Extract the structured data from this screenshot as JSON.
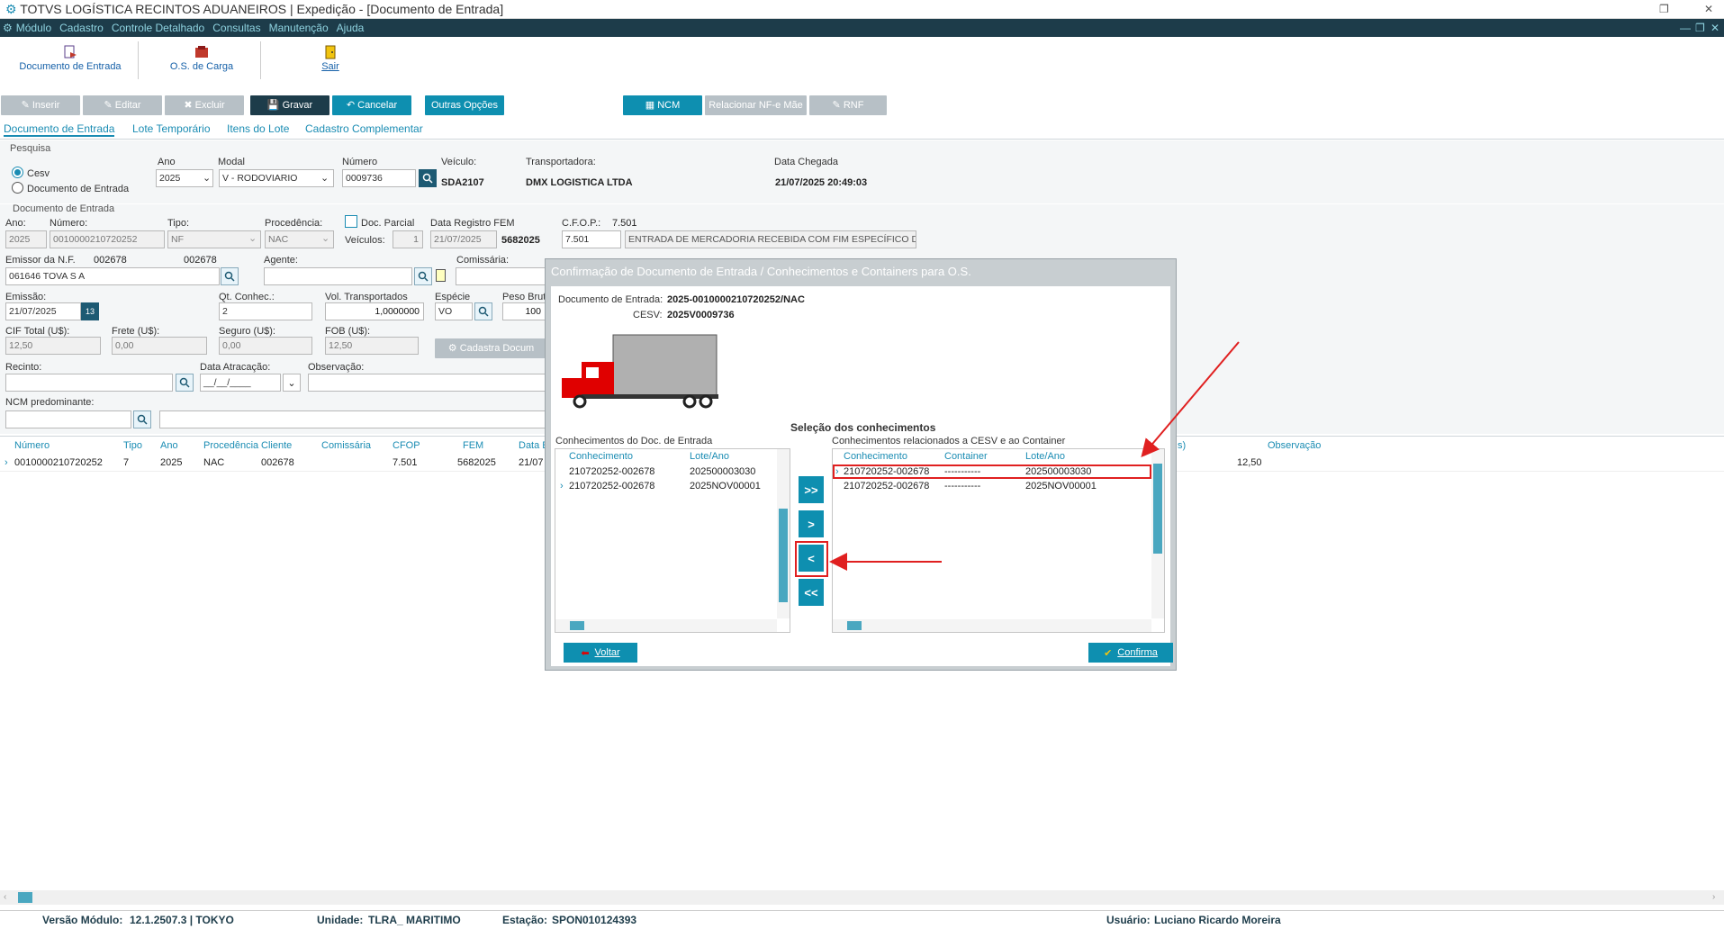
{
  "window": {
    "title": "TOTVS LOGÍSTICA RECINTOS ADUANEIROS | Expedição - [Documento de Entrada]"
  },
  "menu": [
    "Módulo",
    "Cadastro",
    "Controle Detalhado",
    "Consultas",
    "Manutenção",
    "Ajuda"
  ],
  "shortcuts": [
    {
      "label": "Documento de Entrada",
      "icon": "document-entry-icon"
    },
    {
      "label": "O.S. de Carga",
      "icon": "cargo-order-icon"
    },
    {
      "label": "Sair",
      "icon": "exit-door-icon"
    }
  ],
  "toolbar": {
    "inserir": "Inserir",
    "editar": "Editar",
    "excluir": "Excluir",
    "gravar": "Gravar",
    "cancelar": "Cancelar",
    "outras": "Outras Opções",
    "ncm": "NCM",
    "relacionar": "Relacionar NF-e Mãe",
    "rnf": "RNF"
  },
  "tabs": [
    "Documento de Entrada",
    "Lote Temporário",
    "Itens do Lote",
    "Cadastro Complementar"
  ],
  "pesquisa": {
    "title": "Pesquisa",
    "radio_cesv": "Cesv",
    "radio_doc": "Documento de Entrada",
    "ano_label": "Ano",
    "ano": "2025",
    "modal_label": "Modal",
    "modal": "V - RODOVIARIO",
    "numero_label": "Número",
    "numero": "0009736",
    "veiculo_label": "Veículo:",
    "veiculo": "SDA2107",
    "transportadora_label": "Transportadora:",
    "transportadora": "DMX LOGISTICA LTDA",
    "chegada_label": "Data Chegada",
    "chegada": "21/07/2025 20:49:03"
  },
  "doc": {
    "title": "Documento de Entrada",
    "ano_label": "Ano:",
    "ano": "2025",
    "numero_label": "Número:",
    "numero": "0010000210720252",
    "tipo_label": "Tipo:",
    "tipo": "NF",
    "procedencia_label": "Procedência:",
    "procedencia": "NAC",
    "docparcial_label": "Doc. Parcial",
    "veiculos_label": "Veículos:",
    "veiculos": "1",
    "registro_label": "Data Registro FEM",
    "registro": "21/07/2025",
    "fem": "5682025",
    "cfop_label": "C.F.O.P.:",
    "cfop_top": "7.501",
    "cfop": "7.501",
    "cfop_desc": "ENTRADA DE MERCADORIA RECEBIDA COM FIM ESPECÍFICO DE",
    "emissor_label": "Emissor da N.F.",
    "emissor_code1": "002678",
    "emissor_code2": "002678",
    "emissor": "061646  TOVA S A",
    "agente_label": "Agente:",
    "comissaria_label": "Comissária:",
    "emissao_label": "Emissão:",
    "emissao": "21/07/2025",
    "qtconhec_label": "Qt. Conhec.:",
    "qtconhec": "2",
    "vol_label": "Vol. Transportados",
    "vol": "1,0000000",
    "especie_label": "Espécie",
    "especie": "VO",
    "peso_label": "Peso Brut",
    "peso": "100",
    "cif_label": "CIF Total (U$):",
    "cif": "12,50",
    "frete_label": "Frete (U$):",
    "frete": "0,00",
    "seguro_label": "Seguro (U$):",
    "seguro": "0,00",
    "fob_label": "FOB (U$):",
    "fob": "12,50",
    "cadastra": "Cadastra Docum",
    "recinto_label": "Recinto:",
    "atracacao_label": "Data Atracação:",
    "atracacao": "__/__/____",
    "observacao_label": "Observação:",
    "ncm_label": "NCM predominante:"
  },
  "grid": {
    "headers": [
      "Número",
      "Tipo",
      "Ano",
      "Procedência",
      "Cliente",
      "Comissária",
      "CFOP",
      "FEM",
      "Data E",
      "s)",
      "Observação"
    ],
    "row": {
      "numero": "0010000210720252",
      "tipo": "7",
      "ano": "2025",
      "procedencia": "NAC",
      "cliente": "002678",
      "cfop": "7.501",
      "fem": "5682025",
      "data": "21/07",
      "valor": "12,50"
    }
  },
  "dialog": {
    "title": "Confirmação de Documento de Entrada / Conhecimentos  e Containers para O.S.",
    "doc_label": "Documento de Entrada:",
    "doc_value": "2025-0010000210720252/NAC",
    "cesv_label": "CESV:",
    "cesv_value": "2025V0009736",
    "section_title": "Seleção dos conhecimentos",
    "left_title": "Conhecimentos do Doc. de Entrada",
    "right_title": "Conhecimentos relacionados a CESV e ao Container",
    "left_headers": [
      "Conhecimento",
      "Lote/Ano"
    ],
    "right_headers": [
      "Conhecimento",
      "Container",
      "Lote/Ano"
    ],
    "left_rows": [
      {
        "conhecimento": "210720252-002678",
        "lote": "202500003030"
      },
      {
        "conhecimento": "210720252-002678",
        "lote": "2025NOV00001"
      }
    ],
    "right_rows": [
      {
        "conhecimento": "210720252-002678",
        "container": "-----------",
        "lote": "202500003030"
      },
      {
        "conhecimento": "210720252-002678",
        "container": "-----------",
        "lote": "2025NOV00001"
      }
    ],
    "btn_all_right": ">>",
    "btn_right": ">",
    "btn_left": "<",
    "btn_all_left": "<<",
    "voltar": "Voltar",
    "confirma": "Confirma"
  },
  "status": {
    "versao_label": "Versão Módulo:",
    "versao": "12.1.2507.3  |  TOKYO",
    "unidade_label": "Unidade:",
    "unidade": "TLRA_ MARITIMO",
    "estacao_label": "Estação:",
    "estacao": "SPON010124393",
    "usuario_label": "Usuário:",
    "usuario": "Luciano Ricardo Moreira"
  },
  "colors": {
    "accent": "#0e8fb0",
    "menubar": "#1d3c4a",
    "highlight": "#e02020"
  }
}
